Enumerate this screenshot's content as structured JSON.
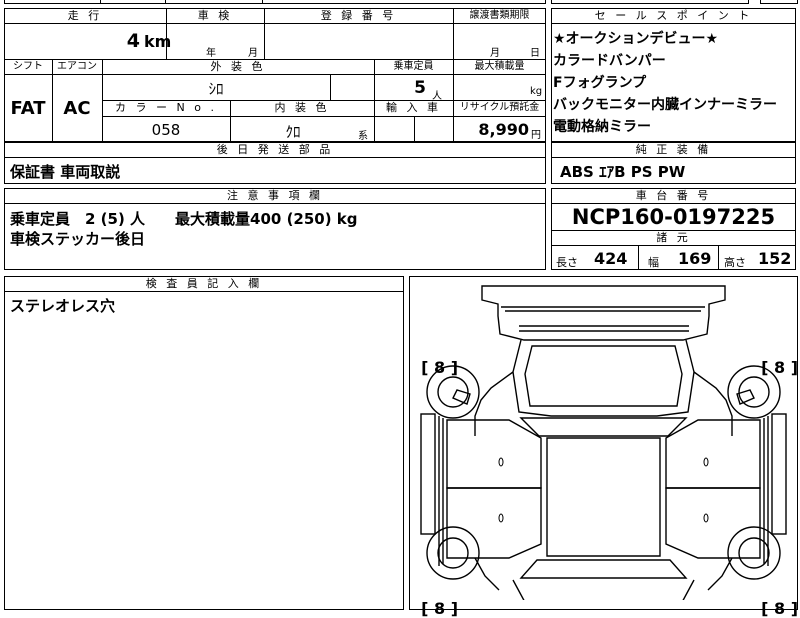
{
  "table": {
    "mileage_label": "走 行",
    "mileage_value": "4",
    "mileage_unit": "km",
    "inspection_label": "車 検",
    "inspection_year_unit": "年",
    "inspection_month_unit": "月",
    "registration_label": "登 録 番 号",
    "transfer_label": "譲渡書類期限",
    "transfer_month_unit": "月",
    "transfer_day_unit": "日",
    "shift_label": "シフト",
    "shift_value": "FAT",
    "aircon_label": "エアコン",
    "aircon_value": "AC",
    "exterior_label": "外 装 色",
    "exterior_value": "ｼﾛ",
    "capacity_label": "乗車定員",
    "capacity_value": "5",
    "capacity_unit": "人",
    "load_label": "最大積載量",
    "load_unit": "kg",
    "color_no_label": "カ ラ ー N o .",
    "color_no_value": "058",
    "interior_label": "内 装 色",
    "interior_value": "ｸﾛ",
    "interior_unit": "系",
    "import_label": "輸 入 車",
    "recycle_label": "リサイクル預託金",
    "recycle_value": "8,990",
    "recycle_unit": "円",
    "later_parts_label": "後 日 発 送 部 品",
    "later_parts_value": "保証書 車両取説"
  },
  "sales_points": {
    "label": "セ ー ル ス ポ イ ン ト",
    "items": [
      "★オークションデビュー★",
      "カラードバンパー",
      "Fフォグランプ",
      "バックモニター内臓インナーミラー",
      "電動格納ミラー"
    ]
  },
  "equipment": {
    "label": "純 正 装 備",
    "value": "ABS ｴｱB PS PW"
  },
  "notes": {
    "label": "注 意 事 項 欄",
    "line1": "乗車定員　2 (5) 人　　最大積載量400 (250) kg",
    "line2": "車検ステッカー後日"
  },
  "chassis": {
    "label": "車 台 番 号",
    "value": "NCP160-0197225"
  },
  "specs": {
    "label": "諸 元",
    "length_label": "長さ",
    "length_value": "424",
    "width_label": "幅",
    "width_value": "169",
    "height_label": "高さ",
    "height_value": "152"
  },
  "inspector": {
    "label": "検 査 員 記 入 欄",
    "value": "ステレオレス穴"
  },
  "diagram": {
    "tire_top_left": "8",
    "tire_top_right": "8",
    "tire_bottom_left": "8",
    "tire_bottom_right": "8",
    "bracket_open": "[",
    "bracket_close": "]"
  }
}
